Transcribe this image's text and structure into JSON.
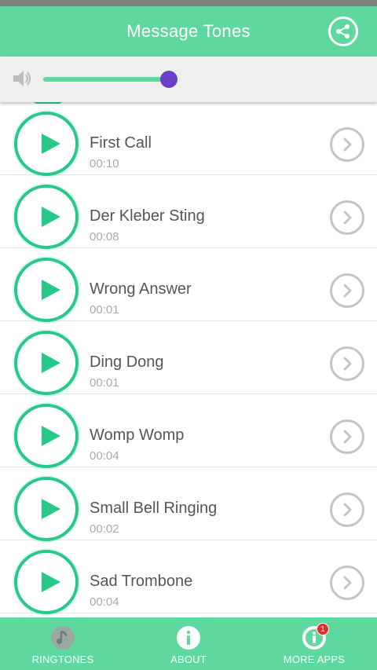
{
  "app_bar": {
    "title": "Message Tones",
    "share_icon": "share-icon"
  },
  "volume": {
    "icon": "speaker-icon",
    "level": 0.85,
    "track_color": "#5fd8a0",
    "thumb_color": "#6a3fc9"
  },
  "tones": [
    {
      "name": "First Call",
      "duration": "00:10"
    },
    {
      "name": "Der Kleber Sting",
      "duration": "00:08"
    },
    {
      "name": "Wrong Answer",
      "duration": "00:01"
    },
    {
      "name": "Ding Dong",
      "duration": "00:01"
    },
    {
      "name": "Womp Womp",
      "duration": "00:04"
    },
    {
      "name": "Small Bell Ringing",
      "duration": "00:02"
    },
    {
      "name": "Sad Trombone",
      "duration": "00:04"
    }
  ],
  "bottom_nav": {
    "items": [
      {
        "label": "RINGTONES",
        "icon": "ringtones-icon"
      },
      {
        "label": "ABOUT",
        "icon": "info-icon"
      },
      {
        "label": "MORE APPS",
        "icon": "more-apps-icon",
        "badge": "1"
      }
    ]
  },
  "colors": {
    "accent": "#5fd8a0",
    "play": "#27c989",
    "chevron": "#c4c4c4"
  }
}
